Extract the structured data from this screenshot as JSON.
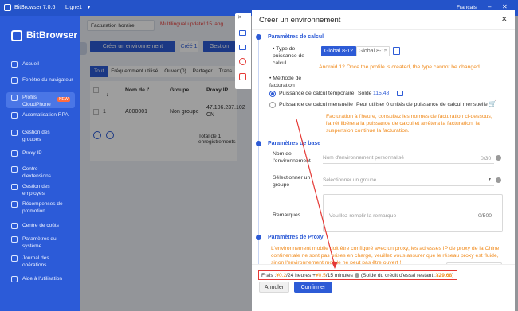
{
  "titlebar": {
    "app": "BitBrowser 7.0.6",
    "line": "Ligne1",
    "lang": "Français"
  },
  "sidebar": {
    "brand": "BitBrowser",
    "items": [
      {
        "label": "Accueil",
        "icon": "home-icon"
      },
      {
        "label": "Fenêtre du navigateur",
        "icon": "window-icon"
      },
      {
        "label": "Profils CloudPhone",
        "icon": "phone-icon",
        "badge": "NEW"
      },
      {
        "label": "Automatisation RPA",
        "icon": "robot-icon"
      },
      {
        "label": "Gestion des groupes",
        "icon": "group-icon"
      },
      {
        "label": "Proxy IP",
        "icon": "globe-icon"
      },
      {
        "label": "Centre d'extensions",
        "icon": "puzzle-icon"
      },
      {
        "label": "Gestion des employés",
        "icon": "users-icon"
      },
      {
        "label": "Récompenses de promotion",
        "icon": "gift-icon"
      },
      {
        "label": "Centre de coûts",
        "icon": "coin-icon"
      },
      {
        "label": "Paramètres du système",
        "icon": "gear-icon"
      },
      {
        "label": "Journal des opérations",
        "icon": "log-icon"
      },
      {
        "label": "Aide à l'utilisation",
        "icon": "help-icon"
      }
    ]
  },
  "main": {
    "billing": "Facturation horaire",
    "notice": "Multilingual update! 15 lang",
    "create_btn": "Créer un environnement",
    "create_short": "Créé 1",
    "manage_btn": "Gestion",
    "tabs": [
      "Tout",
      "Fréquemment utilisé",
      "Ouvert(0)",
      "Partager",
      "Trans"
    ],
    "columns": [
      "Nom de l'...",
      "Groupe",
      "Proxy IP"
    ],
    "row": {
      "num": "1",
      "name": "A000001",
      "group": "Non groupe",
      "ip": "47.106.237.102",
      "country": "CN"
    },
    "footer": "Total de 1 enregistrements"
  },
  "drawer": {
    "title": "Créer un environnement",
    "calc": {
      "title": "Paramètres de calcul",
      "type_label": "Type de puissance de calcul",
      "opt1": "Global 8-12",
      "opt2": "Global 8-15",
      "type_warn": "Android 12.Once the profile is created, the type cannot be changed.",
      "method_label": "Méthode de facturation",
      "radio1": "Puissance de calcul temporaire",
      "balance_label": "Solde",
      "balance": "115.48",
      "radio2": "Puissance de calcul mensuelle",
      "monthly_note": "Peut utiliser 0 unités de puissance de calcul mensuelle",
      "billing_note": "Facturation à l'heure, consultez les normes de facturation ci-dessous, l'arrêt libérera la puissance de calcul et arrêtera la facturation, la suspension continue la facturation."
    },
    "base": {
      "title": "Paramètres de base",
      "name_label": "Nom de l'environnement",
      "name_placeholder": "Nom d'environnement personnalisé",
      "name_count": "0/30",
      "group_label": "Sélectionner un groupe",
      "group_placeholder": "Sélectionner un groupe",
      "remark_label": "Remarques",
      "remark_placeholder": "Veuillez remplir la remarque",
      "remark_count": "0/500"
    },
    "proxy": {
      "title": "Paramètres de Proxy",
      "warn": "L'environnement mobile doit être configuré avec un proxy, les adresses IP de proxy de la Chine continentale ne sont pas prises en charge, veuillez vous assurer que le réseau proxy est fluide, sinon l'environnement mobile ne peut pas être ouvert !"
    },
    "fees": {
      "prefix": "Frais : ",
      "price1": "¥0.2",
      "mid1": "/24 heures + ",
      "price2": "¥0.5",
      "mid2": "/15 minutes",
      "solde": "(Solde du crédit d'essai restant : ",
      "credit": "¥29.68",
      "close": ")"
    },
    "cancel": "Annuler",
    "confirm": "Confirmer"
  },
  "colors": {
    "accent": "#2d5bd6",
    "sidebar": "#2c5bd8",
    "orange": "#f08a1b",
    "red": "#e53935"
  }
}
